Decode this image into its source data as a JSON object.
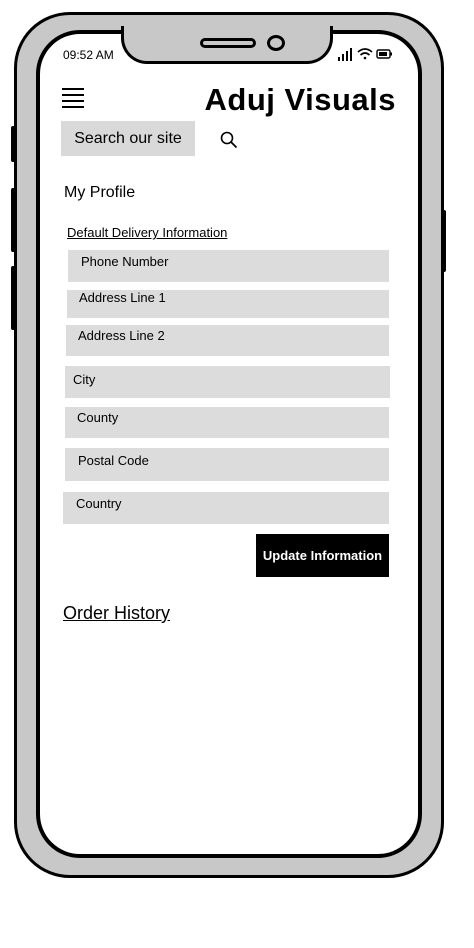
{
  "status_bar": {
    "time": "09:52 AM",
    "icons": [
      "signal-icon",
      "wifi-icon",
      "battery-icon"
    ]
  },
  "header": {
    "brand": "Aduj Visuals",
    "menu_icon": "hamburger-icon"
  },
  "search": {
    "label": "Search our site",
    "icon": "search-icon"
  },
  "profile": {
    "title": "My Profile",
    "section_title": "Default Delivery Information",
    "fields": [
      "Phone Number",
      "Address Line 1",
      "Address Line 2",
      "City",
      "County",
      "Postal Code",
      "Country"
    ],
    "update_label": "Update Information"
  },
  "order_history": {
    "label": "Order History"
  },
  "colors": {
    "field_bg": "#dcdcdc",
    "frame": "#c8c8c8",
    "button_bg": "#000000",
    "button_text": "#ffffff"
  }
}
